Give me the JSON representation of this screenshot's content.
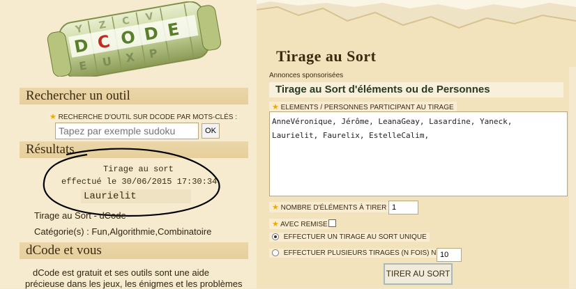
{
  "logo": {
    "letters_row1": [
      "D",
      "C",
      "O",
      "D",
      "E"
    ],
    "letters_row2": [
      "E",
      "U",
      "X",
      "P"
    ],
    "letters_row3": [
      "Y",
      "Z",
      "C",
      "V"
    ]
  },
  "search": {
    "title": "Rechercher un outil",
    "label": "RECHERCHE D'OUTIL SUR DCODE PAR MOTS-CLÉS :",
    "placeholder": "Tapez par exemple sudoku",
    "button": "OK"
  },
  "results": {
    "title": "Résultats",
    "line1": "Tirage au sort",
    "line2": "effectué le 30/06/2015 17:30:34",
    "value": "Laurielit",
    "tool_line": "Tirage au Sort - dCode",
    "category_line": "Catégorie(s) : Fun,Algorithmie,Combinatoire"
  },
  "about": {
    "title": "dCode et vous",
    "line1": "dCode est gratuit et ses outils sont une aide",
    "line2": "précieuse dans les jeux, les énigmes et les problèmes"
  },
  "tool": {
    "title": "Tirage au Sort",
    "sponsored": "Annonces sponsorisées",
    "ad_title": "Tirage au Sort d'éléments ou de Personnes",
    "names_label": "ELEMENTS / PERSONNES PARTICIPANT AU TIRAGE",
    "names_value": "AnneVéronique, Jérôme, LeanaGeay, Lasardine, Yaneck,\nLaurielit, Faurelix, EstelleCalim,",
    "count_label": "NOMBRE D'ÉLÉMENTS À TIRER",
    "count_value": "1",
    "remise_label": "AVEC REMISE",
    "remise_checked": false,
    "radio_single": "EFFECTUER UN TIRAGE AU SORT UNIQUE",
    "radio_multi": "EFFECTUER PLUSIEURS TIRAGES (N FOIS) N=",
    "runs_value": "10",
    "draw_button": "TIRER AU SORT"
  }
}
